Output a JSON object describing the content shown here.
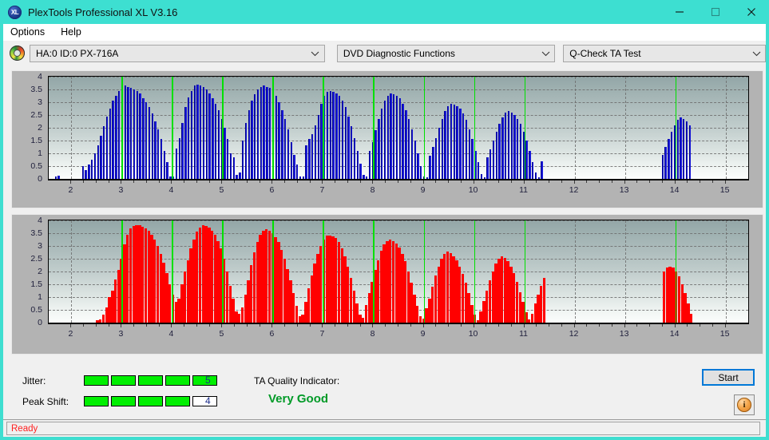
{
  "window": {
    "title": "PlexTools Professional XL V3.16",
    "logo_text": "XL",
    "minimize_icon": "minimize-icon",
    "maximize_icon": "maximize-icon",
    "close_icon": "close-icon"
  },
  "menu": {
    "items": [
      {
        "label": "Options"
      },
      {
        "label": "Help"
      }
    ]
  },
  "toolbar": {
    "drive_icon": "optical-disc-icon",
    "drive_combo": {
      "value": "HA:0 ID:0  PX-716A"
    },
    "function_combo": {
      "value": "DVD Diagnostic Functions"
    },
    "test_combo": {
      "value": "Q-Check TA Test"
    }
  },
  "results": {
    "jitter_label": "Jitter:",
    "jitter_value": "5",
    "jitter_filled": 5,
    "jitter_total": 5,
    "peak_shift_label": "Peak Shift:",
    "peak_shift_value": "4",
    "peak_shift_filled": 4,
    "peak_shift_total": 5,
    "ta_label": "TA Quality Indicator:",
    "ta_value": "Very Good",
    "ta_color": "#009a27",
    "meter_on_color": "#00ef00",
    "start_label": "Start",
    "info_icon": "info-icon",
    "info_glyph": "i"
  },
  "statusbar": {
    "text": "Ready",
    "color": "#ff2020"
  },
  "chart_data": [
    {
      "id": "top",
      "type": "bar",
      "title": "",
      "xlabel": "",
      "ylabel": "",
      "color": "#1818d8",
      "marker_color": "#00e000",
      "xlim": [
        1.55,
        15.45
      ],
      "ylim": [
        0,
        4
      ],
      "grid": true,
      "yticks": [
        0,
        0.5,
        1,
        1.5,
        2,
        2.5,
        3,
        3.5,
        4
      ],
      "ytick_labels": [
        "0",
        "0.5",
        "1",
        "1.5",
        "2",
        "2.5",
        "3",
        "3.5",
        "4"
      ],
      "xticks": [
        2,
        3,
        4,
        5,
        6,
        7,
        8,
        9,
        10,
        11,
        12,
        13,
        14,
        15
      ],
      "xtick_labels": [
        "2",
        "3",
        "4",
        "5",
        "6",
        "7",
        "8",
        "9",
        "10",
        "11",
        "12",
        "13",
        "14",
        "15"
      ],
      "markers": [
        3,
        4,
        5,
        6,
        7,
        8,
        9,
        10,
        11,
        14
      ],
      "x": [
        1.7,
        1.76,
        1.82,
        1.88,
        1.94,
        2.0,
        2.06,
        2.12,
        2.18,
        2.24,
        2.3,
        2.36,
        2.42,
        2.48,
        2.54,
        2.6,
        2.66,
        2.72,
        2.78,
        2.84,
        2.9,
        2.96,
        3.02,
        3.08,
        3.14,
        3.2,
        3.26,
        3.32,
        3.38,
        3.44,
        3.5,
        3.56,
        3.62,
        3.68,
        3.74,
        3.8,
        3.86,
        3.92,
        3.98,
        4.04,
        4.1,
        4.16,
        4.22,
        4.28,
        4.34,
        4.4,
        4.46,
        4.52,
        4.58,
        4.64,
        4.7,
        4.76,
        4.82,
        4.88,
        4.94,
        5.0,
        5.06,
        5.12,
        5.18,
        5.24,
        5.3,
        5.36,
        5.42,
        5.48,
        5.54,
        5.6,
        5.66,
        5.72,
        5.78,
        5.84,
        5.9,
        5.96,
        6.02,
        6.08,
        6.14,
        6.2,
        6.26,
        6.32,
        6.38,
        6.44,
        6.5,
        6.56,
        6.62,
        6.68,
        6.74,
        6.8,
        6.86,
        6.92,
        6.98,
        7.04,
        7.1,
        7.16,
        7.22,
        7.28,
        7.34,
        7.4,
        7.46,
        7.52,
        7.58,
        7.64,
        7.7,
        7.76,
        7.82,
        7.88,
        7.94,
        8.0,
        8.06,
        8.12,
        8.18,
        8.24,
        8.3,
        8.36,
        8.42,
        8.48,
        8.54,
        8.6,
        8.66,
        8.72,
        8.78,
        8.84,
        8.9,
        8.96,
        9.02,
        9.08,
        9.14,
        9.2,
        9.26,
        9.32,
        9.38,
        9.44,
        9.5,
        9.56,
        9.62,
        9.68,
        9.74,
        9.8,
        9.86,
        9.92,
        9.98,
        10.04,
        10.1,
        10.16,
        10.22,
        10.28,
        10.34,
        10.4,
        10.46,
        10.52,
        10.58,
        10.64,
        10.7,
        10.76,
        10.82,
        10.88,
        10.94,
        11.0,
        11.06,
        11.12,
        11.18,
        11.24,
        11.3,
        11.36,
        13.76,
        13.82,
        13.88,
        13.94,
        14.0,
        14.06,
        14.12,
        14.18,
        14.24,
        14.3
      ],
      "values": [
        0.1,
        0.12,
        0,
        0,
        0,
        0,
        0,
        0,
        0,
        0.5,
        0.35,
        0.55,
        0.75,
        1.0,
        1.3,
        1.7,
        2.05,
        2.45,
        2.75,
        3.05,
        3.25,
        3.45,
        3.6,
        3.65,
        3.6,
        3.55,
        3.5,
        3.45,
        3.35,
        3.15,
        3.0,
        2.8,
        2.55,
        2.25,
        1.95,
        1.55,
        1.1,
        0.65,
        0.1,
        0.1,
        1.2,
        1.6,
        2.2,
        2.8,
        3.2,
        3.45,
        3.65,
        3.7,
        3.65,
        3.6,
        3.5,
        3.35,
        3.15,
        2.95,
        2.7,
        2.35,
        2.0,
        1.55,
        1.0,
        0.85,
        0.15,
        0.25,
        1.5,
        2.2,
        2.7,
        3.05,
        3.3,
        3.5,
        3.6,
        3.65,
        3.6,
        3.55,
        3.45,
        3.25,
        3.0,
        2.7,
        2.35,
        1.95,
        1.45,
        0.95,
        0.55,
        0.1,
        0.1,
        1.3,
        1.55,
        1.75,
        2.1,
        2.5,
        2.95,
        3.25,
        3.4,
        3.45,
        3.4,
        3.35,
        3.25,
        3.05,
        2.8,
        2.45,
        2.05,
        1.6,
        1.1,
        0.6,
        0.15,
        0.1,
        1.1,
        1.45,
        1.9,
        2.35,
        2.75,
        3.05,
        3.25,
        3.35,
        3.3,
        3.25,
        3.15,
        2.95,
        2.7,
        2.35,
        1.95,
        1.5,
        1.0,
        0.5,
        0.1,
        0.05,
        0.9,
        1.25,
        1.6,
        2.0,
        2.35,
        2.65,
        2.85,
        2.95,
        2.9,
        2.85,
        2.75,
        2.55,
        2.3,
        1.95,
        1.55,
        1.1,
        0.65,
        0.2,
        0.05,
        0.85,
        1.15,
        1.5,
        1.85,
        2.15,
        2.4,
        2.6,
        2.65,
        2.6,
        2.5,
        2.35,
        2.15,
        1.85,
        1.5,
        1.1,
        0.65,
        0.25,
        0.05,
        0.7,
        0.95,
        1.25,
        1.55,
        1.85,
        2.1,
        2.3,
        2.4,
        2.35,
        2.25,
        2.1,
        1.9,
        1.6,
        1.25,
        0.85,
        0.45,
        0.15,
        0.05,
        0.25,
        0.6,
        0.95,
        1.25,
        1.55,
        1.7,
        1.75,
        1.78,
        1.72,
        1.6,
        1.4,
        1.15,
        0.8,
        0.4,
        0.12,
        0.7,
        1.05,
        1.35,
        1.6,
        1.78,
        1.8,
        1.72,
        1.55,
        1.25,
        0.85
      ]
    },
    {
      "id": "bottom",
      "type": "bar",
      "title": "",
      "xlabel": "",
      "ylabel": "",
      "color": "#ff0000",
      "marker_color": "#00e000",
      "xlim": [
        1.55,
        15.45
      ],
      "ylim": [
        0,
        4
      ],
      "grid": true,
      "yticks": [
        0,
        0.5,
        1,
        1.5,
        2,
        2.5,
        3,
        3.5,
        4
      ],
      "ytick_labels": [
        "0",
        "0.5",
        "1",
        "1.5",
        "2",
        "2.5",
        "3",
        "3.5",
        "4"
      ],
      "xticks": [
        2,
        3,
        4,
        5,
        6,
        7,
        8,
        9,
        10,
        11,
        12,
        13,
        14,
        15
      ],
      "xtick_labels": [
        "2",
        "3",
        "4",
        "5",
        "6",
        "7",
        "8",
        "9",
        "10",
        "11",
        "12",
        "13",
        "14",
        "15"
      ],
      "markers": [
        3,
        4,
        5,
        6,
        7,
        8,
        9,
        10,
        11,
        14
      ],
      "x": [
        2.52,
        2.58,
        2.64,
        2.7,
        2.76,
        2.82,
        2.88,
        2.94,
        3.0,
        3.06,
        3.12,
        3.18,
        3.24,
        3.3,
        3.36,
        3.42,
        3.48,
        3.54,
        3.6,
        3.66,
        3.72,
        3.78,
        3.84,
        3.9,
        3.96,
        4.02,
        4.08,
        4.14,
        4.2,
        4.26,
        4.32,
        4.38,
        4.44,
        4.5,
        4.56,
        4.62,
        4.68,
        4.74,
        4.8,
        4.86,
        4.92,
        4.98,
        5.04,
        5.1,
        5.16,
        5.22,
        5.28,
        5.34,
        5.4,
        5.46,
        5.52,
        5.58,
        5.64,
        5.7,
        5.76,
        5.82,
        5.88,
        5.94,
        6.0,
        6.06,
        6.12,
        6.18,
        6.24,
        6.3,
        6.36,
        6.42,
        6.48,
        6.54,
        6.6,
        6.66,
        6.72,
        6.78,
        6.84,
        6.9,
        6.96,
        7.02,
        7.08,
        7.14,
        7.2,
        7.26,
        7.32,
        7.38,
        7.44,
        7.5,
        7.56,
        7.62,
        7.68,
        7.74,
        7.8,
        7.86,
        7.92,
        7.98,
        8.04,
        8.1,
        8.16,
        8.22,
        8.28,
        8.34,
        8.4,
        8.46,
        8.52,
        8.58,
        8.64,
        8.7,
        8.76,
        8.82,
        8.88,
        8.94,
        9.0,
        9.06,
        9.12,
        9.18,
        9.24,
        9.3,
        9.36,
        9.42,
        9.48,
        9.54,
        9.6,
        9.66,
        9.72,
        9.78,
        9.84,
        9.9,
        9.96,
        10.02,
        10.08,
        10.14,
        10.2,
        10.26,
        10.32,
        10.38,
        10.44,
        10.5,
        10.56,
        10.62,
        10.68,
        10.74,
        10.8,
        10.86,
        10.92,
        10.98,
        11.04,
        11.1,
        11.16,
        11.22,
        11.28,
        11.34,
        11.4,
        13.78,
        13.84,
        13.9,
        13.96,
        14.02,
        14.08,
        14.14,
        14.2,
        14.26,
        14.32
      ],
      "values": [
        0.1,
        0.12,
        0.3,
        0.6,
        1.0,
        1.25,
        1.7,
        2.05,
        2.5,
        3.05,
        3.45,
        3.7,
        3.78,
        3.82,
        3.8,
        3.75,
        3.7,
        3.6,
        3.45,
        3.25,
        3.0,
        2.7,
        2.35,
        1.95,
        1.5,
        1.1,
        0.8,
        0.95,
        1.5,
        2.0,
        2.45,
        2.9,
        3.25,
        3.55,
        3.72,
        3.8,
        3.78,
        3.72,
        3.6,
        3.45,
        3.2,
        2.9,
        2.5,
        2.0,
        1.45,
        0.95,
        0.45,
        0.35,
        0.6,
        1.1,
        1.65,
        2.25,
        2.75,
        3.15,
        3.45,
        3.6,
        3.65,
        3.6,
        3.5,
        3.35,
        3.15,
        2.85,
        2.5,
        2.1,
        1.65,
        1.15,
        0.65,
        0.25,
        0.3,
        0.8,
        1.35,
        1.85,
        2.3,
        2.7,
        3.0,
        3.25,
        3.4,
        3.42,
        3.38,
        3.3,
        3.15,
        2.9,
        2.6,
        2.2,
        1.75,
        1.25,
        0.75,
        0.3,
        0.2,
        0.7,
        1.15,
        1.6,
        2.05,
        2.45,
        2.8,
        3.05,
        3.2,
        3.25,
        3.2,
        3.1,
        2.95,
        2.7,
        2.4,
        2.0,
        1.55,
        1.1,
        0.65,
        0.25,
        0.15,
        0.55,
        0.95,
        1.4,
        1.85,
        2.2,
        2.5,
        2.7,
        2.78,
        2.72,
        2.6,
        2.45,
        2.2,
        1.9,
        1.55,
        1.15,
        0.7,
        0.3,
        0.1,
        0.45,
        0.85,
        1.25,
        1.65,
        2.0,
        2.3,
        2.5,
        2.58,
        2.52,
        2.4,
        2.2,
        1.95,
        1.6,
        1.2,
        0.8,
        0.4,
        0.12,
        0.35,
        0.75,
        1.1,
        1.45,
        1.75,
        2.0,
        2.15,
        2.2,
        2.15,
        2.0,
        1.8,
        1.5,
        1.15,
        0.75,
        0.35,
        0.1,
        0.3,
        0.6,
        0.95,
        1.25,
        1.5,
        1.68,
        1.75,
        1.72,
        1.6,
        1.4,
        1.1,
        0.75,
        0.4,
        0.12,
        0.85,
        1.15,
        1.45,
        1.68,
        1.8,
        1.78,
        1.68,
        1.45,
        1.15,
        0.7
      ]
    }
  ]
}
